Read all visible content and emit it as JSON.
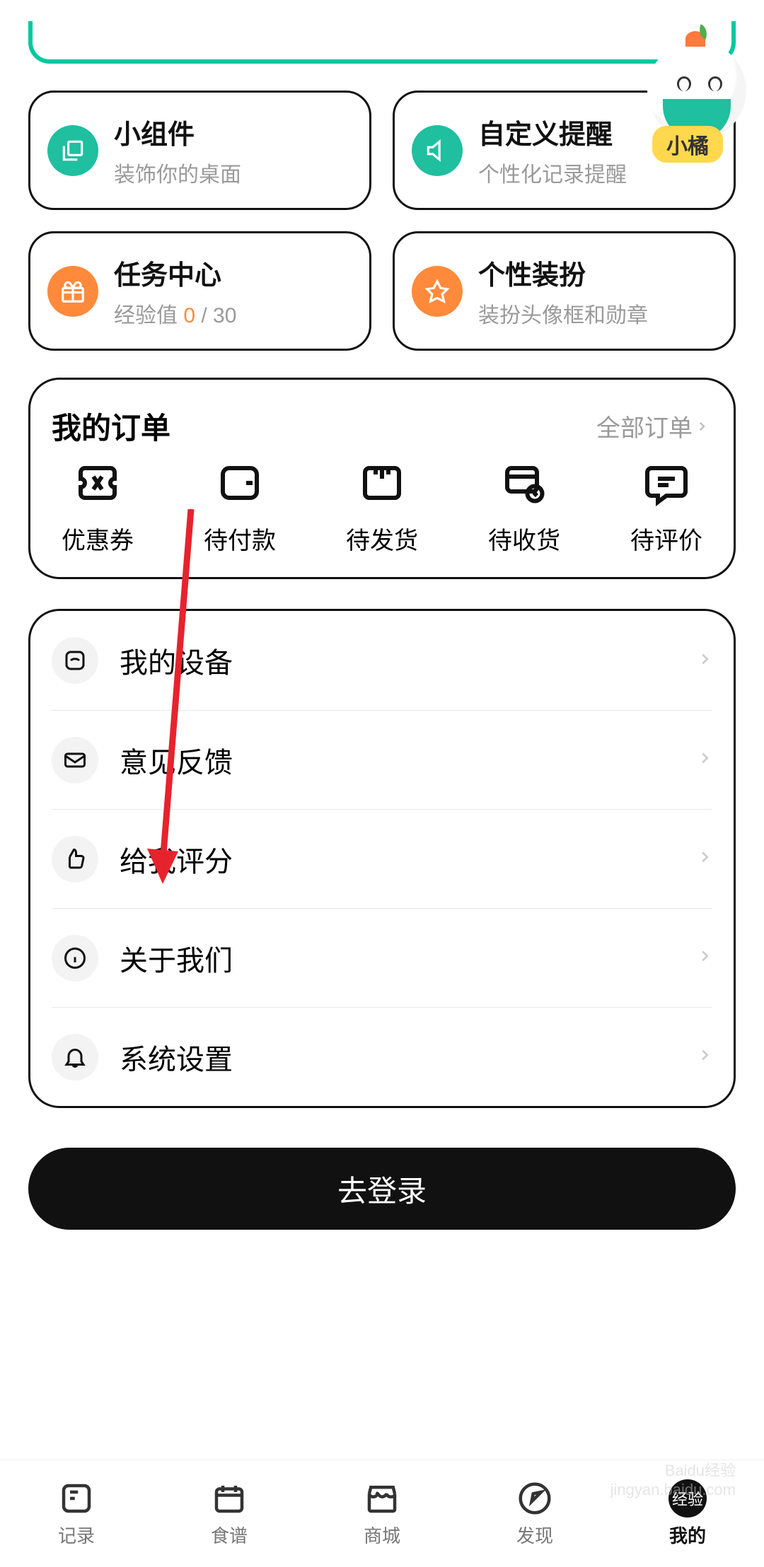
{
  "mascot": {
    "label": "小橘"
  },
  "cards": {
    "widget": {
      "title": "小组件",
      "sub": "装饰你的桌面"
    },
    "custom_remind": {
      "title": "自定义提醒",
      "sub": "个性化记录提醒"
    },
    "task_center": {
      "title": "任务中心",
      "xp_label": "经验值",
      "xp_current": "0",
      "xp_total": "30"
    },
    "dressup": {
      "title": "个性装扮",
      "sub": "装扮头像框和勋章"
    }
  },
  "orders": {
    "title": "我的订单",
    "all": "全部订单",
    "items": [
      "优惠券",
      "待付款",
      "待发货",
      "待收货",
      "待评价"
    ]
  },
  "settings": {
    "items": [
      "我的设备",
      "意见反馈",
      "给我评分",
      "关于我们",
      "系统设置"
    ]
  },
  "login_button": "去登录",
  "tabs": {
    "items": [
      "记录",
      "食谱",
      "商城",
      "发现",
      "我的"
    ],
    "avatar_text": "经验"
  },
  "watermark": {
    "l1": "Baidu经验",
    "l2": "jingyan.baidu.com"
  }
}
